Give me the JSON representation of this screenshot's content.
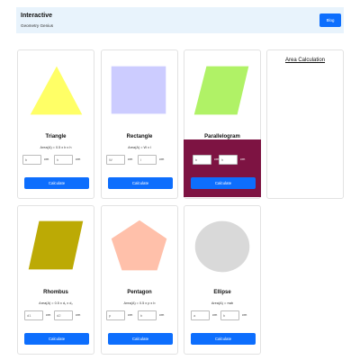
{
  "header": {
    "title": "Interactive",
    "subtitle": "Geometry Genius",
    "blog_label": "Blog"
  },
  "side_panel": {
    "title": "Area Calculation"
  },
  "cards": [
    {
      "name": "Triangle",
      "formula": "Area(A) = 0.5 x b x h",
      "inputs": [
        {
          "placeholder": "b",
          "unit": "cm"
        },
        {
          "placeholder": "h",
          "unit": "cm"
        }
      ],
      "button": "Calculate",
      "color": "#ffff66"
    },
    {
      "name": "Rectangle",
      "formula": "Area(A) = W x l",
      "inputs": [
        {
          "placeholder": "W",
          "unit": "cm"
        },
        {
          "placeholder": "l",
          "unit": "cm"
        }
      ],
      "button": "Calculate",
      "color": "#ccccff"
    },
    {
      "name": "Parallelogram",
      "formula": "",
      "inputs": [
        {
          "placeholder": "b",
          "unit": "cm"
        },
        {
          "placeholder": "h",
          "unit": "cm"
        }
      ],
      "button": "Calculate",
      "color": "#b0f266",
      "highlight_color": "#7d1342"
    },
    {
      "name": "Rhombus",
      "formula": "Area(A) = 0.5 x d₁ x d₂",
      "inputs": [
        {
          "placeholder": "d1",
          "unit": "cm"
        },
        {
          "placeholder": "d2",
          "unit": "cm"
        }
      ],
      "button": "Calculate",
      "color": "#bcaa05"
    },
    {
      "name": "Pentagon",
      "formula": "Area(A) = 0.5 x p x b",
      "inputs": [
        {
          "placeholder": "p",
          "unit": "cm"
        },
        {
          "placeholder": "b",
          "unit": "cm"
        }
      ],
      "button": "Calculate",
      "color": "#ffc0aa"
    },
    {
      "name": "Ellipse",
      "formula": "Area(A) = πab",
      "inputs": [
        {
          "placeholder": "a",
          "unit": "cm"
        },
        {
          "placeholder": "b",
          "unit": "cm"
        }
      ],
      "button": "Calculate",
      "color": "#d9d9d9"
    }
  ]
}
